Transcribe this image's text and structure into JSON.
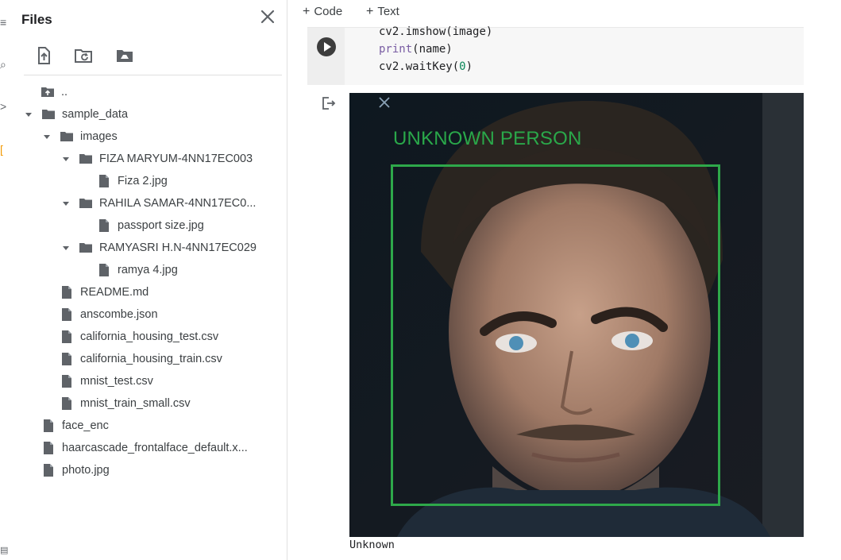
{
  "rail": {
    "glyphs": [
      "≡",
      "⌕",
      ">",
      "[",
      "▤"
    ]
  },
  "files_panel": {
    "title": "Files",
    "parent_dir": "..",
    "tree": [
      {
        "label": "sample_data",
        "type": "folder",
        "depth": 0,
        "expanded": true
      },
      {
        "label": "images",
        "type": "folder",
        "depth": 1,
        "expanded": true
      },
      {
        "label": "FIZA MARYUM-4NN17EC003",
        "type": "folder",
        "depth": 2,
        "expanded": true
      },
      {
        "label": "Fiza 2.jpg",
        "type": "file",
        "depth": 3
      },
      {
        "label": "RAHILA SAMAR-4NN17EC0...",
        "type": "folder",
        "depth": 2,
        "expanded": true
      },
      {
        "label": "passport size.jpg",
        "type": "file",
        "depth": 3
      },
      {
        "label": "RAMYASRI H.N-4NN17EC029",
        "type": "folder",
        "depth": 2,
        "expanded": true
      },
      {
        "label": "ramya 4.jpg",
        "type": "file",
        "depth": 3
      },
      {
        "label": "README.md",
        "type": "file",
        "depth": 1
      },
      {
        "label": "anscombe.json",
        "type": "file",
        "depth": 1
      },
      {
        "label": "california_housing_test.csv",
        "type": "file",
        "depth": 1
      },
      {
        "label": "california_housing_train.csv",
        "type": "file",
        "depth": 1
      },
      {
        "label": "mnist_test.csv",
        "type": "file",
        "depth": 1
      },
      {
        "label": "mnist_train_small.csv",
        "type": "file",
        "depth": 1
      },
      {
        "label": "face_enc",
        "type": "file",
        "depth": 0
      },
      {
        "label": "haarcascade_frontalface_default.x...",
        "type": "file",
        "depth": 0
      },
      {
        "label": "photo.jpg",
        "type": "file",
        "depth": 0
      }
    ]
  },
  "notebook": {
    "add_code": "Code",
    "add_text": "Text",
    "code_lines": [
      {
        "fn": "cv2.imshow",
        "args": "(image)"
      },
      {
        "fn": "print",
        "args": "(name)"
      },
      {
        "fn": "cv2.waitKey(",
        "num": "0",
        "tail": ")"
      }
    ],
    "overlay_label": "UNKNOWN PERSON",
    "output_text": "Unknown"
  },
  "colors": {
    "box": "#2ea84a",
    "label": "#2aa84a"
  }
}
